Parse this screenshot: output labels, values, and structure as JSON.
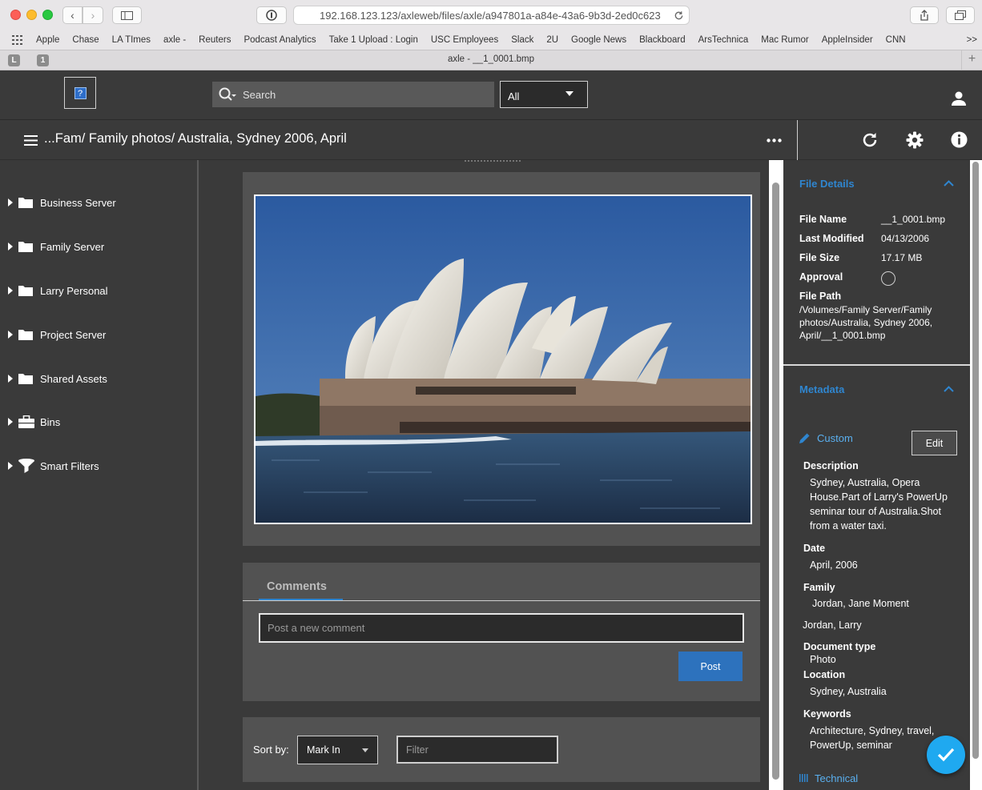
{
  "browser": {
    "url": "192.168.123.123/axleweb/files/axle/a947801a-a84e-43a6-9b3d-2ed0c623",
    "tab_title": "axle - __1_0001.bmp",
    "tab_badges": [
      "L",
      "1"
    ],
    "bookmarks": [
      "Apple",
      "Chase",
      "LA TImes",
      "axle -",
      "Reuters",
      "Podcast Analytics",
      "Take 1 Upload : Login",
      "USC Employees",
      "Slack",
      "2U",
      "Google News",
      "Blackboard",
      "ArsTechnica",
      "Mac Rumor",
      "AppleInsider",
      "CNN"
    ],
    "more": ">>"
  },
  "header": {
    "search_placeholder": "Search",
    "scope_value": "All"
  },
  "titlebar": {
    "breadcrumb": "...Fam/ Family photos/ Australia, Sydney 2006, April"
  },
  "sidebar": {
    "items": [
      {
        "label": "Business Server",
        "icon": "folder-icon"
      },
      {
        "label": "Family Server",
        "icon": "folder-icon"
      },
      {
        "label": "Larry Personal",
        "icon": "folder-icon"
      },
      {
        "label": "Project Server",
        "icon": "folder-icon"
      },
      {
        "label": "Shared Assets",
        "icon": "folder-icon"
      },
      {
        "label": "Bins",
        "icon": "briefcase-icon"
      },
      {
        "label": "Smart Filters",
        "icon": "funnel-icon"
      }
    ]
  },
  "comments": {
    "tab_label": "Comments",
    "input_placeholder": "Post a new comment",
    "post_label": "Post"
  },
  "sort": {
    "label": "Sort by:",
    "value": "Mark In",
    "filter_placeholder": "Filter"
  },
  "file_details": {
    "title": "File Details",
    "file_name_label": "File Name",
    "file_name": "__1_0001.bmp",
    "last_modified_label": "Last Modified",
    "last_modified": "04/13/2006",
    "file_size_label": "File Size",
    "file_size": "17.17 MB",
    "approval_label": "Approval",
    "file_path_label": "File Path",
    "file_path": "/Volumes/Family Server/Family photos/Australia, Sydney 2006, April/__1_0001.bmp"
  },
  "metadata": {
    "title": "Metadata",
    "custom_label": "Custom",
    "edit_label": "Edit",
    "description_label": "Description",
    "description": "Sydney, Australia, Opera House.Part of Larry's PowerUp seminar tour of Australia.Shot from a water taxi.",
    "date_label": "Date",
    "date": "April, 2006",
    "family_label": "Family",
    "family_1": "Jordan, Jane Moment",
    "family_2": "Jordan, Larry",
    "doctype_label": "Document type",
    "doctype": "Photo",
    "location_label": "Location",
    "location": "Sydney, Australia",
    "keywords_label": "Keywords",
    "keywords": "Architecture, Sydney, travel, PowerUp, seminar",
    "technical_label": "Technical"
  },
  "colors": {
    "accent": "#2f86d0",
    "fab": "#1fa9f0",
    "post_button": "#2d72bd"
  }
}
